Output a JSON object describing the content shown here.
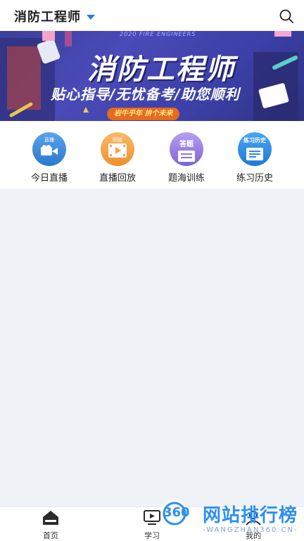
{
  "header": {
    "title": "消防工程师",
    "search_icon": "search-icon",
    "dropdown_icon": "caret-down-icon",
    "accent": "#1f80e0"
  },
  "banner": {
    "subtitle": "2020 FIRE ENGINEERS",
    "title": "消防工程师",
    "slogan": "贴心指导/无忧备考/助您顺利",
    "tag": "岩牛乎年 拚个未来"
  },
  "quick_entries": [
    {
      "label": "今日直播",
      "icon": "video-camera-icon",
      "badge": "直播",
      "color": "#3a8ee0"
    },
    {
      "label": "直播回放",
      "icon": "replay-icon",
      "badge": "回放",
      "color": "#f3a545"
    },
    {
      "label": "题海训练",
      "icon": "exam-icon",
      "badge": "答题",
      "color": "#9b7fe0"
    },
    {
      "label": "练习历史",
      "icon": "history-icon",
      "badge": "练习历史",
      "color": "#2a8fe8"
    }
  ],
  "tabbar": {
    "tabs": [
      {
        "label": "首页",
        "icon": "home-icon"
      },
      {
        "label": "学习",
        "icon": "study-icon"
      },
      {
        "label": "我的",
        "icon": "profile-icon"
      }
    ]
  },
  "watermark": {
    "logo_text": "360",
    "title": "网站排行榜",
    "url": "-WANGZHAN360.CN-"
  }
}
